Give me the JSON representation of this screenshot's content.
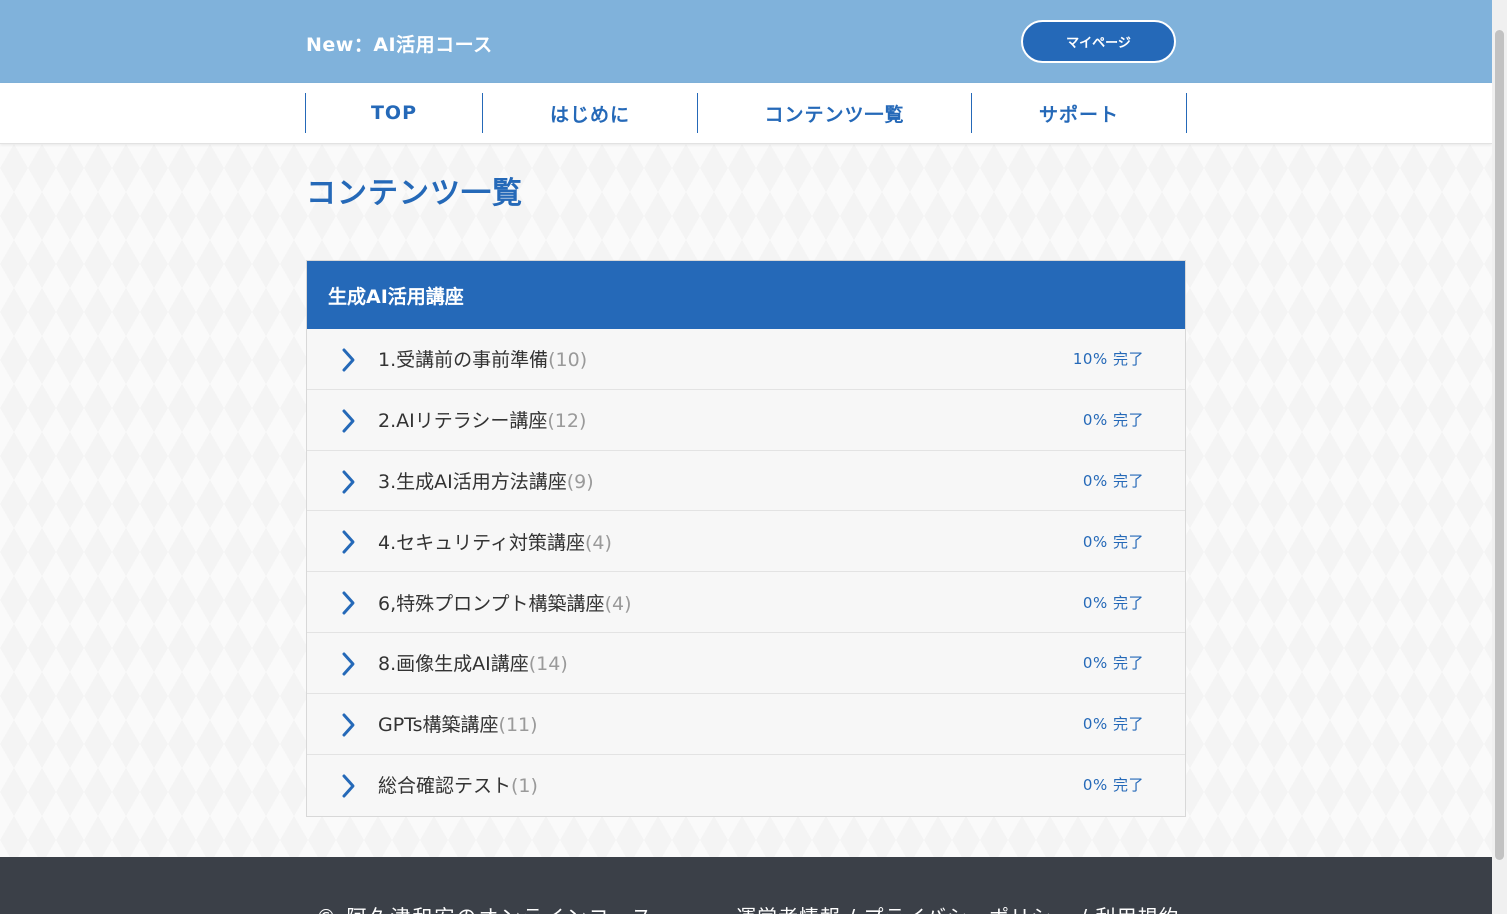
{
  "header": {
    "site_title": "New：AI活用コース",
    "mypage_label": "マイページ"
  },
  "nav": [
    {
      "label": "TOP"
    },
    {
      "label": "はじめに"
    },
    {
      "label": "コンテンツ一覧"
    },
    {
      "label": "サポート"
    }
  ],
  "page_title": "コンテンツ一覧",
  "section": {
    "title": "生成AI活用講座",
    "items": [
      {
        "label": "1.受講前の事前準備",
        "count": "(10)",
        "progress": "10% 完了"
      },
      {
        "label": "2.AIリテラシー講座",
        "count": "(12)",
        "progress": "0% 完了"
      },
      {
        "label": "3.生成AI活用方法講座",
        "count": "(9)",
        "progress": "0% 完了"
      },
      {
        "label": "4.セキュリティ対策講座",
        "count": "(4)",
        "progress": "0% 完了"
      },
      {
        "label": "6,特殊プロンプト構築講座",
        "count": "(4)",
        "progress": "0% 完了"
      },
      {
        "label": "8.画像生成AI講座",
        "count": "(14)",
        "progress": "0% 完了"
      },
      {
        "label": "GPTs構築講座",
        "count": "(11)",
        "progress": "0% 完了"
      },
      {
        "label": "総合確認テスト",
        "count": "(1)",
        "progress": "0% 完了"
      }
    ]
  },
  "footer": {
    "copyright": "© 阿久津和宏のオンラインコース",
    "links": "運営者情報 / プライバシーポリシー / 利用規約"
  },
  "colors": {
    "accent": "#2569b8",
    "header_bg": "#80b2db",
    "footer_bg": "#3b4048"
  }
}
